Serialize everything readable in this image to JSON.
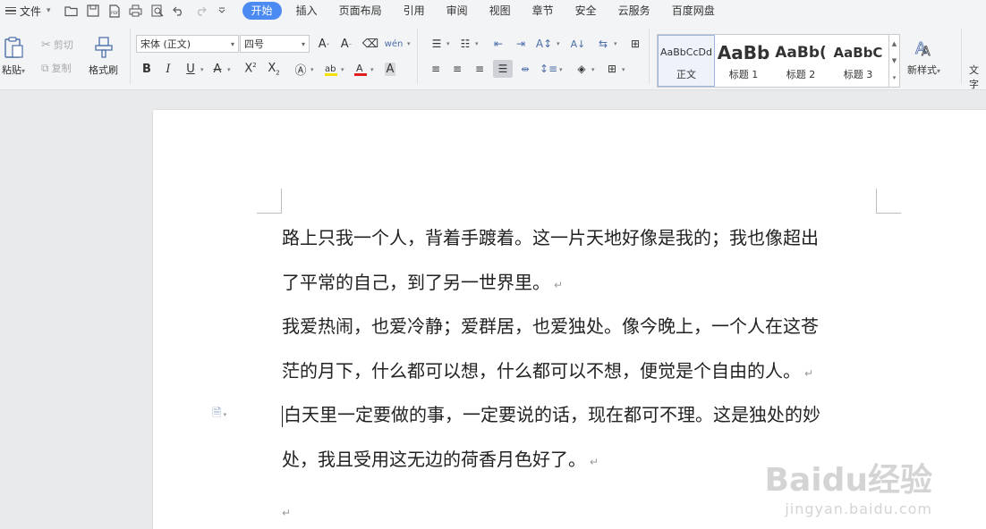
{
  "menu": {
    "file_label": "文件",
    "tabs": [
      "开始",
      "插入",
      "页面布局",
      "引用",
      "审阅",
      "视图",
      "章节",
      "安全",
      "云服务",
      "百度网盘"
    ]
  },
  "ribbon": {
    "paste_label": "粘贴",
    "cut_label": "剪切",
    "copy_label": "复制",
    "format_painter_label": "格式刷",
    "font_name": "宋体 (正文)",
    "font_size": "四号",
    "styles": [
      {
        "preview": "AaBbCcDd",
        "name": "正文"
      },
      {
        "preview": "AaBb",
        "name": "标题 1"
      },
      {
        "preview": "AaBb(",
        "name": "标题 2"
      },
      {
        "preview": "AaBbC",
        "name": "标题 3"
      }
    ],
    "new_style_label": "新样式",
    "text_tool_label": "文字"
  },
  "document": {
    "paragraphs": [
      [
        "路上只我一个人，背着手踱着。这一片天地好像是我的；我也像超出",
        "了平常的自己，到了另一世界里。"
      ],
      [
        "我爱热闹，也爱冷静；爱群居，也爱独处。像今晚上，一个人在这苍",
        "茫的月下，什么都可以想，什么都可以不想，便觉是个自由的人。"
      ],
      [
        "白天里一定要做的事，一定要说的话，现在都可不理。这是独处的妙",
        "处，我且受用这无边的荷香月色好了。"
      ]
    ],
    "para_mark": "↵"
  },
  "watermark": {
    "logo": "Baidu经验",
    "url": "jingyan.baidu.com"
  },
  "colors": {
    "accent": "#4b8af0",
    "highlight": "#f5e000",
    "font_color": "#e02020"
  }
}
